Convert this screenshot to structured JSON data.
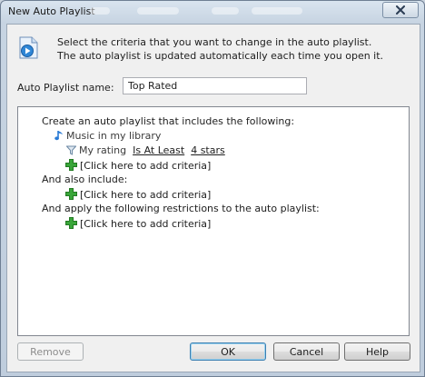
{
  "window": {
    "title": "New Auto Playlist"
  },
  "header": {
    "line1": "Select the criteria that you want to change in the auto playlist.",
    "line2": "The auto playlist is updated automatically each time you open it."
  },
  "name_field": {
    "label": "Auto Playlist name:",
    "value": "Top Rated"
  },
  "criteria": {
    "section1": "Create an auto playlist that includes the following:",
    "source": "Music in my library",
    "rule": {
      "field": "My rating",
      "operator": "Is At Least",
      "value": "4 stars"
    },
    "add1": "[Click here to add criteria]",
    "section2": "And also include:",
    "add2": "[Click here to add criteria]",
    "section3": "And apply the following restrictions to the auto playlist:",
    "add3": "[Click here to add criteria]"
  },
  "buttons": {
    "remove": "Remove",
    "ok": "OK",
    "cancel": "Cancel",
    "help": "Help"
  },
  "colors": {
    "plus_green": "#3aa63a",
    "note_blue": "#2a7bd6",
    "filter_gray": "#6d8aa5"
  }
}
